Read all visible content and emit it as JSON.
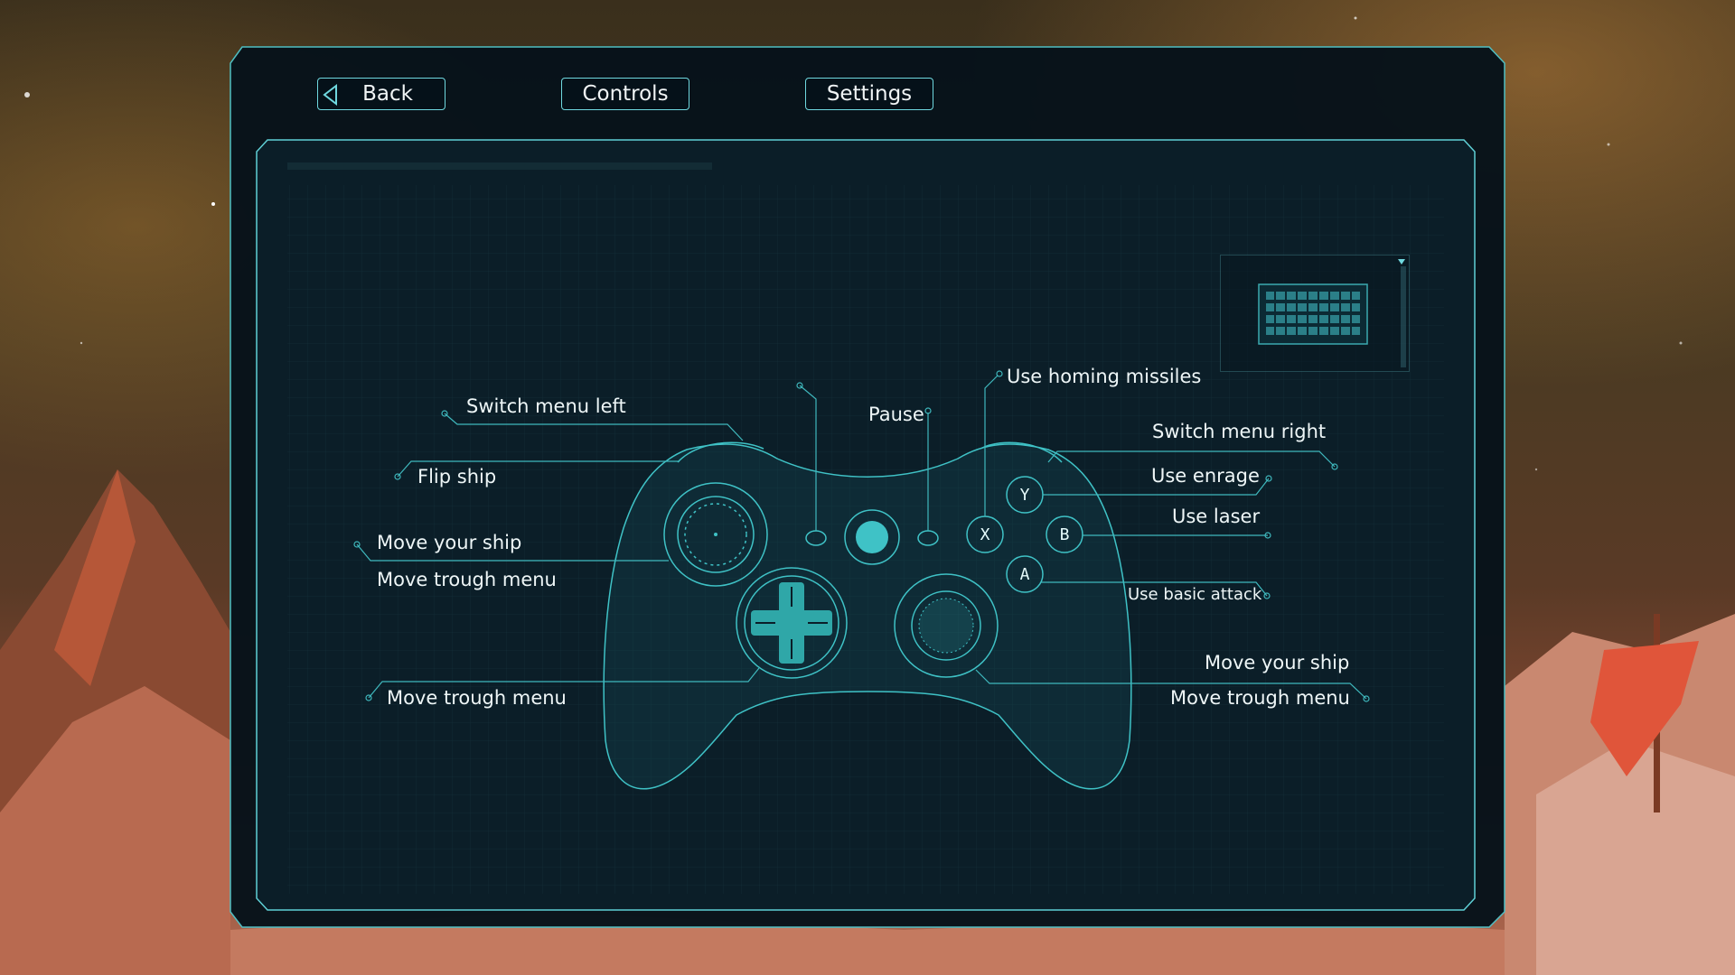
{
  "nav": {
    "back_label": "Back",
    "controls_label": "Controls",
    "settings_label": "Settings"
  },
  "device_toggle": {
    "current": "keyboard-icon"
  },
  "bindings": {
    "switch_menu_left": "Switch menu left",
    "flip_ship": "Flip ship",
    "move_your_ship_left": "Move your ship",
    "move_trough_menu_left": "Move trough menu",
    "move_trough_menu_dpad": "Move trough menu",
    "pause": "Pause",
    "use_homing_missiles": "Use homing missiles",
    "switch_menu_right": "Switch menu right",
    "use_enrage": "Use enrage",
    "use_laser": "Use laser",
    "use_basic_attack": "Use basic attack",
    "move_your_ship_right": "Move your ship",
    "move_trough_menu_right": "Move trough menu"
  },
  "buttons": {
    "y": "Y",
    "b": "B",
    "x": "X",
    "a": "A"
  },
  "colors": {
    "accent": "#6fd8df",
    "panel": "#0a1a24",
    "dpad": "#2fa7a8"
  }
}
